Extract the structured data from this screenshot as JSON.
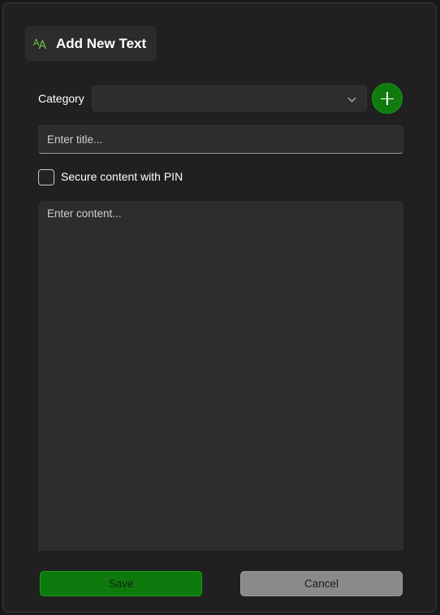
{
  "dialog": {
    "title": "Add New Text",
    "title_icon": "font-size-icon"
  },
  "category": {
    "label": "Category",
    "selected_value": "",
    "add_icon": "plus-icon"
  },
  "title_field": {
    "value": "",
    "placeholder": "Enter title..."
  },
  "secure": {
    "label": "Secure content with PIN",
    "checked": false
  },
  "content_field": {
    "value": "",
    "placeholder": "Enter content..."
  },
  "buttons": {
    "save_label": "Save",
    "cancel_label": "Cancel"
  },
  "colors": {
    "accent": "#0f7b0f",
    "icon_green": "#6cc24a",
    "background": "#202020",
    "field": "#2d2d2d"
  }
}
